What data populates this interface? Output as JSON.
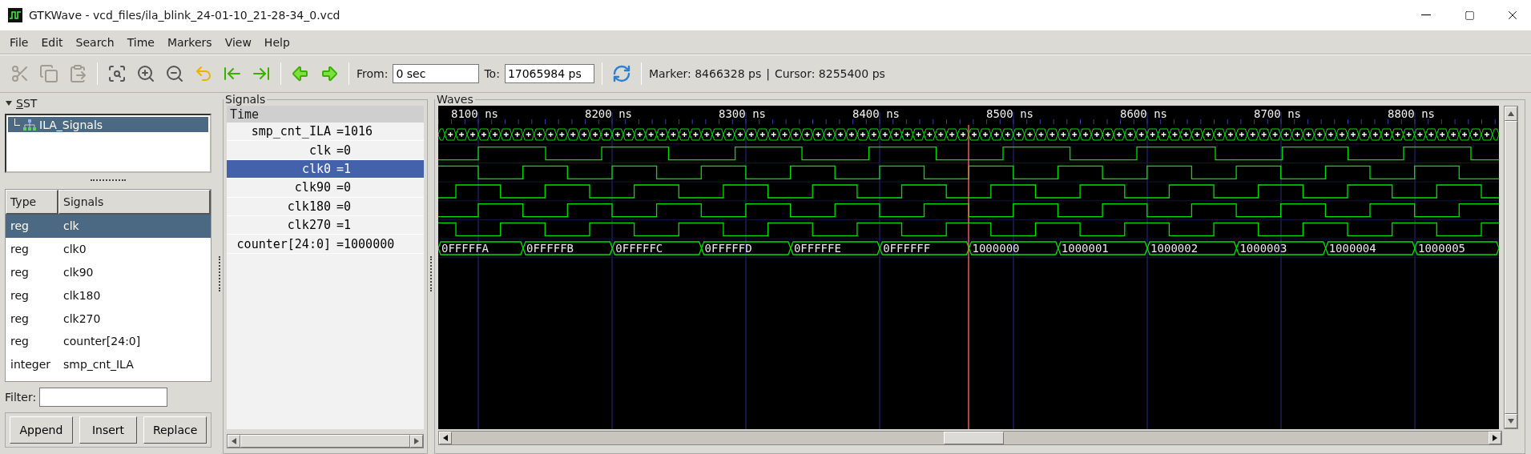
{
  "window": {
    "title": "GTKWave - vcd_files/ila_blink_24-01-10_21-28-34_0.vcd"
  },
  "menu": [
    "File",
    "Edit",
    "Search",
    "Time",
    "Markers",
    "View",
    "Help"
  ],
  "toolbar": {
    "buttons": [
      {
        "kind": "cut",
        "disabled": true
      },
      {
        "kind": "copy",
        "disabled": true
      },
      {
        "kind": "paste",
        "disabled": true
      },
      {
        "kind": "separator"
      },
      {
        "kind": "zoom-fit",
        "disabled": false
      },
      {
        "kind": "zoom-in",
        "disabled": false
      },
      {
        "kind": "zoom-out",
        "disabled": false
      },
      {
        "kind": "undo",
        "disabled": false
      },
      {
        "kind": "to-start",
        "disabled": false
      },
      {
        "kind": "to-end",
        "disabled": false
      },
      {
        "kind": "separator"
      },
      {
        "kind": "back",
        "disabled": false
      },
      {
        "kind": "forward",
        "disabled": false
      }
    ],
    "from": {
      "label": "From:",
      "value": "0 sec"
    },
    "to": {
      "label": "To:",
      "value": "17065984 ps"
    },
    "marker": "Marker: 8466328 ps",
    "divider": "|",
    "cursor": "Cursor: 8255400 ps"
  },
  "sst": {
    "title": "SST",
    "expanded": true,
    "tree": [
      {
        "label": "ILA_Signals",
        "selected": true
      }
    ],
    "columns": [
      "Type",
      "Signals"
    ],
    "rows": [
      {
        "type": "reg",
        "name": "clk",
        "selected": true
      },
      {
        "type": "reg",
        "name": "clk0",
        "selected": false
      },
      {
        "type": "reg",
        "name": "clk90",
        "selected": false
      },
      {
        "type": "reg",
        "name": "clk180",
        "selected": false
      },
      {
        "type": "reg",
        "name": "clk270",
        "selected": false
      },
      {
        "type": "reg",
        "name": "counter[24:0]",
        "selected": false
      },
      {
        "type": "integer",
        "name": "smp_cnt_ILA",
        "selected": false
      }
    ],
    "filter": {
      "label": "Filter:"
    },
    "buttons": [
      "Append",
      "Insert",
      "Replace"
    ]
  },
  "signals": {
    "title": "Signals",
    "header": "Time",
    "rows": [
      {
        "name": "smp_cnt_ILA",
        "value": "=1016",
        "selected": false
      },
      {
        "name": "clk",
        "value": "=0",
        "selected": false
      },
      {
        "name": "clk0",
        "value": "=1",
        "selected": true
      },
      {
        "name": "clk90",
        "value": "=0",
        "selected": false
      },
      {
        "name": "clk180",
        "value": "=0",
        "selected": false
      },
      {
        "name": "clk270",
        "value": "=1",
        "selected": false
      },
      {
        "name": "counter[24:0]",
        "value": "=1000000",
        "selected": false
      }
    ]
  },
  "waves": {
    "title": "Waves",
    "ticks": [
      "8100 ns",
      "8200 ns",
      "8300 ns",
      "8400 ns",
      "8500 ns",
      "8600 ns",
      "8700 ns",
      "8800 ns"
    ],
    "traces": [
      {
        "kind": "compressed"
      },
      {
        "kind": "clock"
      },
      {
        "kind": "clock"
      },
      {
        "kind": "clock"
      },
      {
        "kind": "clock"
      },
      {
        "kind": "clock"
      },
      {
        "kind": "bus",
        "segments": [
          "0FFFFFA",
          "0FFFFFB",
          "0FFFFFC",
          "0FFFFFD",
          "0FFFFFE",
          "0FFFFFF",
          "1000000",
          "1000001",
          "1000002",
          "1000003",
          "1000004",
          "1000005"
        ]
      }
    ]
  }
}
